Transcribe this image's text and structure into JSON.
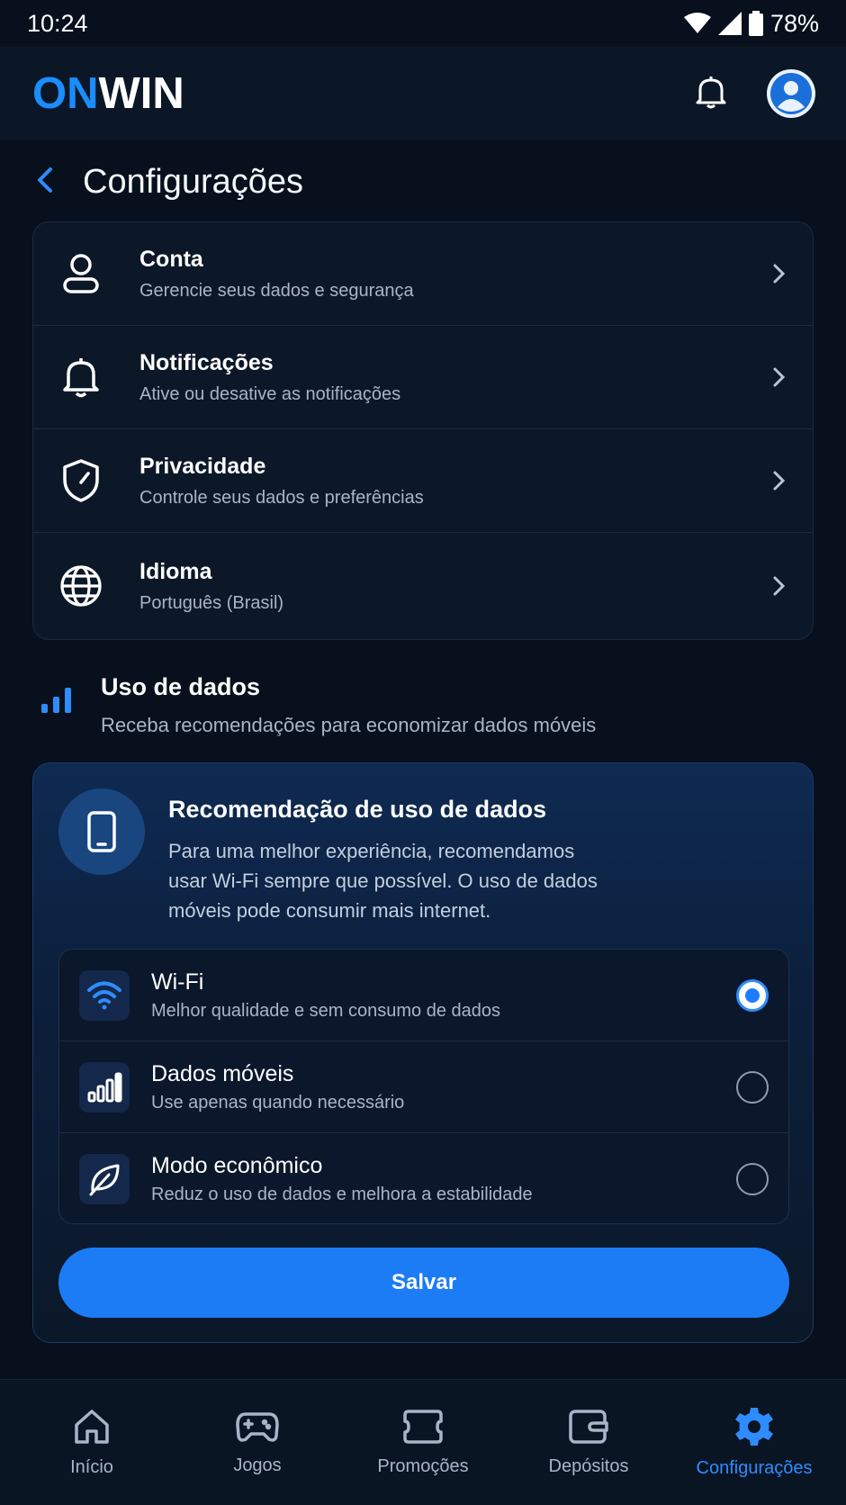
{
  "status_bar": {
    "time": "10:24",
    "battery": "78%"
  },
  "app_bar": {
    "logo_on": "ON",
    "logo_win": "WIN",
    "brand_color": "#1b8dff"
  },
  "page": {
    "title": "Configurações"
  },
  "settings": [
    {
      "icon": "user-icon",
      "title": "Conta",
      "subtitle": "Gerencie seus dados e segurança"
    },
    {
      "icon": "bell-icon",
      "title": "Notificações",
      "subtitle": "Ative ou desative as notificações"
    },
    {
      "icon": "shield-icon",
      "title": "Privacidade",
      "subtitle": "Controle seus dados e preferências"
    },
    {
      "icon": "globe-icon",
      "title": "Idioma",
      "subtitle": "Português (Brasil)"
    }
  ],
  "data_usage": {
    "title": "Uso de dados",
    "subtitle": "Receba recomendações para economizar dados móveis"
  },
  "recommendation": {
    "title": "Recomendação de uso de dados",
    "description": "Para uma melhor experiência, recomendamos usar Wi-Fi sempre que possível. O uso de dados móveis pode consumir mais internet.",
    "options": [
      {
        "icon": "wifi-icon",
        "title": "Wi-Fi",
        "subtitle": "Melhor qualidade e sem consumo de dados",
        "selected": true
      },
      {
        "icon": "signal-bars-icon",
        "title": "Dados móveis",
        "subtitle": "Use apenas quando necessário",
        "selected": false
      },
      {
        "icon": "leaf-icon",
        "title": "Modo econômico",
        "subtitle": "Reduz o uso de dados e melhora a estabilidade",
        "selected": false
      }
    ],
    "save_label": "Salvar"
  },
  "bottom_nav": [
    {
      "icon": "home-icon",
      "label": "Início",
      "active": false
    },
    {
      "icon": "gamepad-icon",
      "label": "Jogos",
      "active": false
    },
    {
      "icon": "ticket-icon",
      "label": "Promoções",
      "active": false
    },
    {
      "icon": "wallet-icon",
      "label": "Depósitos",
      "active": false
    },
    {
      "icon": "gear-icon",
      "label": "Configurações",
      "active": true
    }
  ],
  "colors": {
    "accent": "#1c7cf6",
    "background": "#07101c",
    "active_nav": "#2f8cff"
  }
}
